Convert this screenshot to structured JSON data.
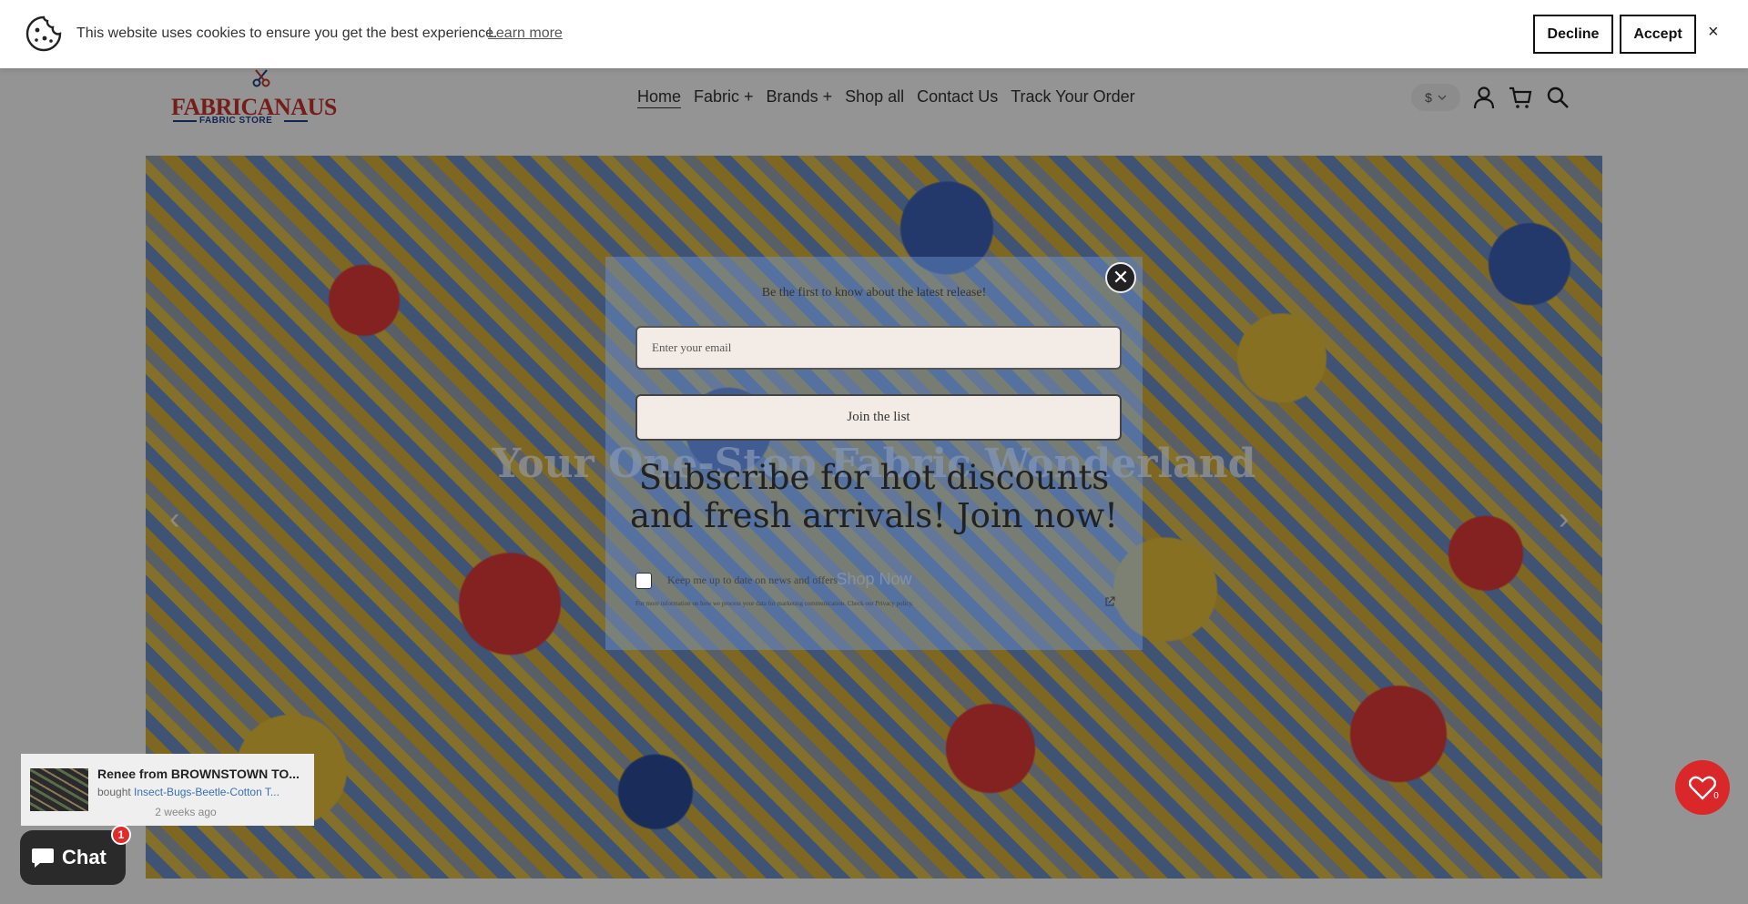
{
  "cookie": {
    "message": "This website uses cookies to ensure you get the best experience.",
    "learn_more": "Learn more",
    "decline": "Decline",
    "accept": "Accept",
    "close": "×"
  },
  "header": {
    "logo_main": "FABRICANAUS",
    "logo_sub": "FABRIC STORE",
    "nav": [
      "Home",
      "Fabric +",
      "Brands +",
      "Shop all",
      "Contact Us",
      "Track Your Order"
    ],
    "currency": "$",
    "icons": [
      "account-icon",
      "cart-icon",
      "search-icon"
    ]
  },
  "hero": {
    "title": "Your One-Stop Fabric Wonderland",
    "cta": "Shop Now"
  },
  "popup": {
    "tagline": "Be the first to know about the latest release!",
    "email_placeholder": "Enter your email",
    "join": "Join the list",
    "headline": "Subscribe for hot discounts and fresh arrivals! Join now!",
    "checkbox_label": "Keep me up to date on news and offers",
    "fine_print": "For more information on how we process your data for marketing communication. Check our Privacy policy."
  },
  "purchase": {
    "name": "Renee from BROWNSTOWN TO...",
    "bought_prefix": "bought",
    "product": "Insect-Bugs-Beetle-Cotton T...",
    "time": "2 weeks ago"
  },
  "chat": {
    "label": "Chat",
    "badge": "1"
  },
  "wishlist": {
    "count": "0"
  },
  "colors": {
    "brand_red": "#c8342c",
    "brand_blue": "#1f3f8a",
    "wishlist_red": "#d9272a",
    "chat_dark": "#2a2a2a"
  }
}
